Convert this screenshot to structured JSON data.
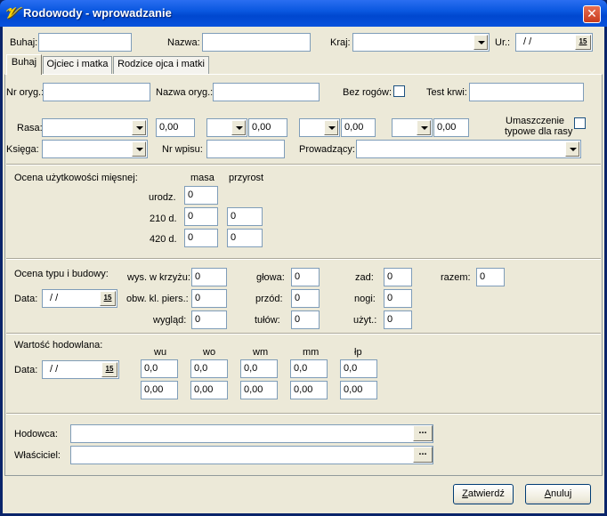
{
  "window": {
    "title": "Rodowody - wprowadzanie",
    "close_glyph": "✕",
    "icon": "app-logo-icon",
    "icon_glyph": "𝒱"
  },
  "header": {
    "buhaj_label": "Buhaj:",
    "buhaj_value": "",
    "nazwa_label": "Nazwa:",
    "nazwa_value": "",
    "kraj_label": "Kraj:",
    "kraj_value": "",
    "ur_label": "Ur.:",
    "ur_value": "/ /"
  },
  "tabs": [
    {
      "label": "Buhaj",
      "active": true
    },
    {
      "label": "Ojciec i matka",
      "active": false
    },
    {
      "label": "Rodzice ojca i matki",
      "active": false
    }
  ],
  "calendar_glyph": "15",
  "ellipsis_glyph": "...",
  "general": {
    "nr_oryg_label": "Nr oryg.:",
    "nr_oryg_value": "",
    "nazwa_oryg_label": "Nazwa oryg.:",
    "nazwa_oryg_value": "",
    "bez_rogow_label": "Bez rogów:",
    "bez_rogow_checked": false,
    "test_krwi_label": "Test krwi:",
    "test_krwi_value": "",
    "rasa_label": "Rasa:",
    "rasa_values": [
      "0,00",
      "0,00",
      "0,00",
      "0,00"
    ],
    "umaszczenie_label_1": "Umaszczenie",
    "umaszczenie_label_2": "typowe dla rasy",
    "umaszczenie_checked": false,
    "ksiega_label": "Księga:",
    "nr_wpisu_label": "Nr wpisu:",
    "nr_wpisu_value": "",
    "prowadzacy_label": "Prowadzący:",
    "prowadzacy_value": ""
  },
  "meat": {
    "title": "Ocena użytkowości mięsnej:",
    "col_masa": "masa",
    "col_przyrost": "przyrost",
    "row_urodz": "urodz.",
    "row_210": "210 d.",
    "row_420": "420 d.",
    "urodz_masa": "0",
    "d210_masa": "0",
    "d210_przyrost": "0",
    "d420_masa": "0",
    "d420_przyrost": "0"
  },
  "type_eval": {
    "title": "Ocena typu i budowy:",
    "data_label": "Data:",
    "data_value": "/ /",
    "wys_label": "wys. w krzyżu:",
    "wys_value": "0",
    "obw_label": "obw. kl. piers.:",
    "obw_value": "0",
    "wyglad_label": "wygląd:",
    "wyglad_value": "0",
    "glowa_label": "głowa:",
    "glowa_value": "0",
    "przod_label": "przód:",
    "przod_value": "0",
    "tulow_label": "tułów:",
    "tulow_value": "0",
    "zad_label": "zad:",
    "zad_value": "0",
    "nogi_label": "nogi:",
    "nogi_value": "0",
    "uzyt_label": "użyt.:",
    "uzyt_value": "0",
    "razem_label": "razem:",
    "razem_value": "0"
  },
  "breeding": {
    "title": "Wartość hodowlana:",
    "data_label": "Data:",
    "data_value": "/ /",
    "cols": [
      "wu",
      "wo",
      "wm",
      "mm",
      "łp"
    ],
    "row1": [
      "0,0",
      "0,0",
      "0,0",
      "0,0",
      "0,0"
    ],
    "row2": [
      "0,00",
      "0,00",
      "0,00",
      "0,00",
      "0,00"
    ]
  },
  "owner": {
    "hodowca_label": "Hodowca:",
    "hodowca_value": "",
    "wlasciciel_label": "Właściciel:",
    "wlasciciel_value": ""
  },
  "footer": {
    "confirm_label": "Zatwierdź",
    "cancel_label": "Anuluj"
  }
}
